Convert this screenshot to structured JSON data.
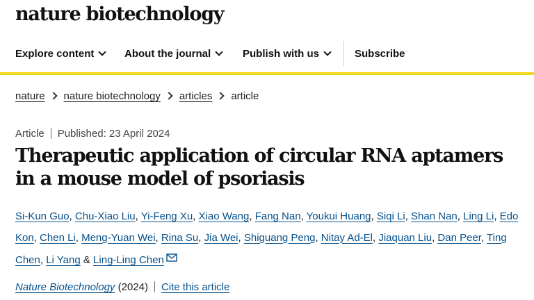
{
  "site": {
    "brand": "nature biotechnology"
  },
  "nav": {
    "items": [
      {
        "label": "Explore content"
      },
      {
        "label": "About the journal"
      },
      {
        "label": "Publish with us"
      }
    ],
    "subscribe": "Subscribe"
  },
  "colors": {
    "accent_rule": "#f2d81e",
    "link": "#07508a"
  },
  "breadcrumb": [
    {
      "label": "nature"
    },
    {
      "label": "nature biotechnology"
    },
    {
      "label": "articles"
    },
    {
      "label": "article"
    }
  ],
  "article": {
    "type": "Article",
    "published": "Published: 23 April 2024",
    "title": "Therapeutic application of circular RNA aptamers in a mouse model of psoriasis",
    "authors": [
      "Si-Kun Guo",
      "Chu-Xiao Liu",
      "Yi-Feng Xu",
      "Xiao Wang",
      "Fang Nan",
      "Youkui Huang",
      "Siqi Li",
      "Shan Nan",
      "Ling Li",
      "Edo Kon",
      "Chen Li",
      "Meng-Yuan Wei",
      "Rina Su",
      "Jia Wei",
      "Shiguang Peng",
      "Nitay Ad-El",
      "Jiaquan Liu",
      "Dan Peer",
      "Ting Chen",
      "Li Yang",
      "Ling-Ling Chen"
    ],
    "author_separator": ", ",
    "last_author_joiner": " & ",
    "corresponding_icon": "mail-icon",
    "journal": "Nature Biotechnology",
    "year": "(2024)",
    "cite_label": "Cite this article"
  }
}
